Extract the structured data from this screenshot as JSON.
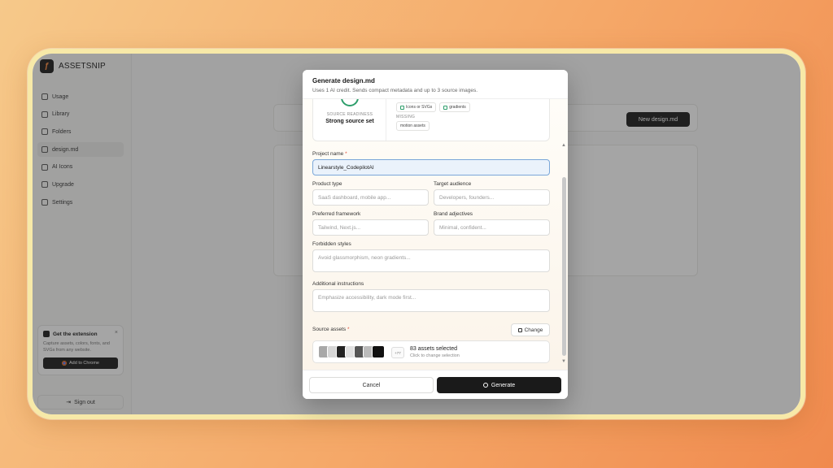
{
  "sidebar": {
    "brand": "ASSETSNIP",
    "items": [
      {
        "label": "Usage",
        "active": false
      },
      {
        "label": "Library",
        "active": false
      },
      {
        "label": "Folders",
        "active": false
      },
      {
        "label": "design.md",
        "active": true
      },
      {
        "label": "AI Icons",
        "active": false
      },
      {
        "label": "Upgrade",
        "active": false
      },
      {
        "label": "Settings",
        "active": false
      }
    ],
    "extension": {
      "title": "Get the extension",
      "close": "×",
      "description": "Capture assets, colors, fonts, and SVGs from any website.",
      "button": "Add to Chrome"
    },
    "signout": "Sign out"
  },
  "background": {
    "new_button": "New design.md"
  },
  "modal": {
    "title": "Generate design.md",
    "subtitle": "Uses 1 AI credit. Sends compact metadata and up to 3 source images.",
    "readiness": {
      "label": "SOURCE READINESS",
      "value": "Strong source set",
      "present": [
        "Icons or SVGs",
        "gradients"
      ],
      "missing_label": "MISSING",
      "missing": [
        "motion assets"
      ]
    },
    "fields": {
      "project_name": {
        "label": "Project name",
        "required": "*",
        "value": "Linearstyle_CodepilotAI"
      },
      "product_type": {
        "label": "Product type",
        "placeholder": "SaaS dashboard, mobile app..."
      },
      "target_audience": {
        "label": "Target audience",
        "placeholder": "Developers, founders..."
      },
      "preferred_framework": {
        "label": "Preferred framework",
        "placeholder": "Tailwind, Next.js..."
      },
      "brand_adjectives": {
        "label": "Brand adjectives",
        "placeholder": "Minimal, confident..."
      },
      "forbidden_styles": {
        "label": "Forbidden styles",
        "placeholder": "Avoid glassmorphism, neon gradients..."
      },
      "additional_instructions": {
        "label": "Additional instructions",
        "placeholder": "Emphasize accessibility, dark mode first..."
      }
    },
    "source_assets": {
      "label": "Source assets",
      "required": "*",
      "change": "Change",
      "more": "+77",
      "count": "83 assets selected",
      "hint": "Click to change selection"
    },
    "cancel": "Cancel",
    "generate": "Generate"
  }
}
